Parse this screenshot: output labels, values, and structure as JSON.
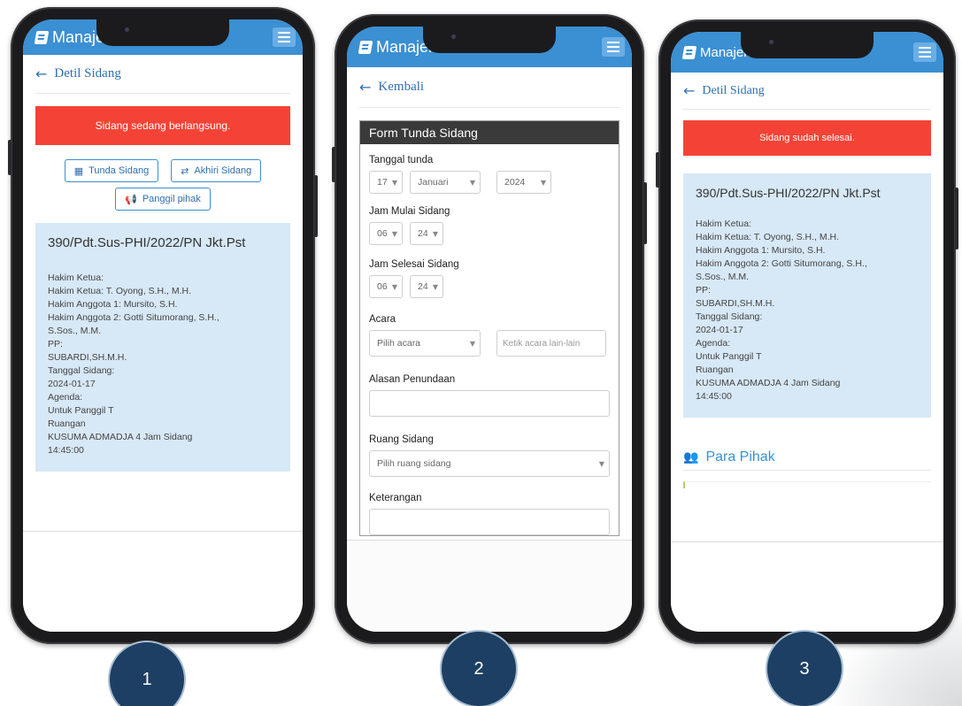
{
  "app": {
    "brand": "Manajemen",
    "menu_icon": "hamburger-icon",
    "accent": "#3b8fd3"
  },
  "phone1": {
    "back_label": "Detil Sidang",
    "alert": "Sidang sedang berlangsung.",
    "buttons": {
      "tunda": "Tunda Sidang",
      "akhiri": "Akhiri Sidang",
      "panggil": "Panggil pihak"
    },
    "case_number": "390/Pdt.Sus-PHI/2022/PN Jkt.Pst",
    "details": [
      "Hakim Ketua:",
      "Hakim Ketua: T. Oyong, S.H., M.H.",
      "Hakim Anggota 1: Mursito, S.H.",
      "Hakim Anggota 2: Gotti Situmorang, S.H.,",
      "S.Sos., M.M.",
      "PP:",
      "SUBARDI,SH.M.H.",
      "Tanggal Sidang:",
      "2024-01-17",
      "Agenda:",
      "Untuk Panggil T",
      "Ruangan",
      "KUSUMA ADMADJA 4 Jam Sidang",
      "14:45:00"
    ]
  },
  "phone2": {
    "back_label": "Kembali",
    "form_title": "Form Tunda Sidang",
    "tanggal_label": "Tanggal tunda",
    "tanggal": {
      "day": "17",
      "month": "Januari",
      "year": "2024"
    },
    "mulai_label": "Jam Mulai Sidang",
    "mulai": {
      "hour": "06",
      "minute": "24"
    },
    "selesai_label": "Jam Selesai Sidang",
    "selesai": {
      "hour": "06",
      "minute": "24"
    },
    "acara_label": "Acara",
    "acara_select": "Pilih acara",
    "acara_placeholder": "Ketik acara lain-lain",
    "alasan_label": "Alasan Penundaan",
    "ruang_label": "Ruang Sidang",
    "ruang_select": "Pilih ruang sidang",
    "keterangan_label": "Keterangan"
  },
  "phone3": {
    "back_label": "Detil Sidang",
    "alert": "Sidang sudah selesai.",
    "case_number": "390/Pdt.Sus-PHI/2022/PN Jkt.Pst",
    "details": [
      "Hakim Ketua:",
      "Hakim Ketua: T. Oyong, S.H., M.H.",
      "Hakim Anggota 1: Mursito, S.H.",
      "Hakim Anggota 2: Gotti Situmorang, S.H.,",
      "S.Sos., M.M.",
      "PP:",
      "SUBARDI,SH.M.H.",
      "Tanggal Sidang:",
      "2024-01-17",
      "Agenda:",
      "Untuk Panggil T",
      "Ruangan",
      "KUSUMA ADMADJA 4 Jam Sidang",
      "14:45:00"
    ],
    "para_pihak": "Para Pihak"
  },
  "badges": [
    "1",
    "2",
    "3"
  ]
}
